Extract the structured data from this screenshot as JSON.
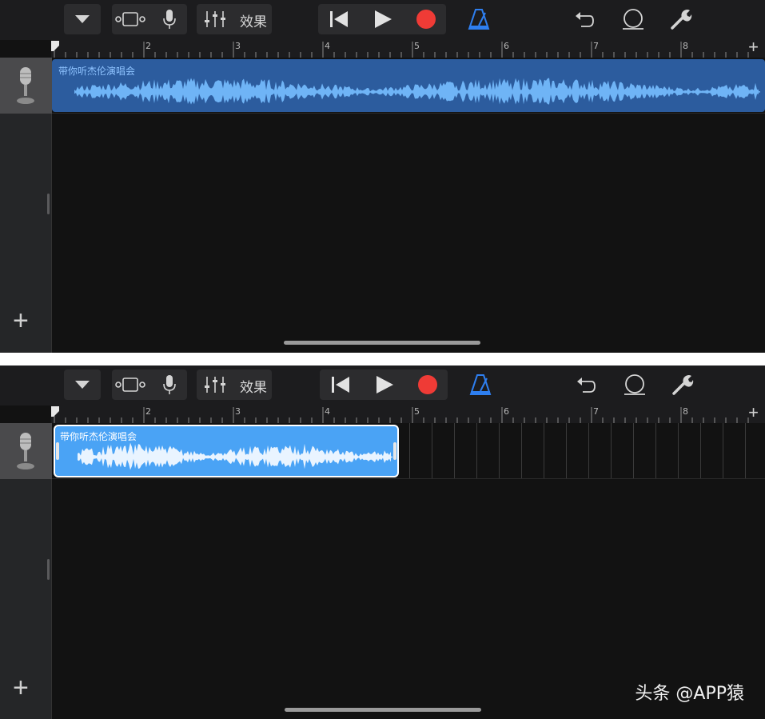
{
  "toolbar": {
    "fx_label": "效果"
  },
  "ruler": {
    "bars": [
      "2",
      "3",
      "4",
      "5",
      "6",
      "7",
      "8"
    ]
  },
  "top_panel": {
    "region_label": "带你听杰伦演唱会"
  },
  "bottom_panel": {
    "region_label": "带你听杰伦演唱会"
  },
  "watermark": {
    "text": "头条 @APP猿"
  },
  "colors": {
    "region_unselected": "#2c5c9e",
    "region_selected": "#4aa3f5",
    "waveform": "#6fb4f6",
    "record": "#ef3b36",
    "metronome": "#2e7ff0"
  },
  "icons": [
    "dropdown-icon",
    "track-view-icon",
    "microphone-icon",
    "mixer-icon",
    "rewind-icon",
    "play-icon",
    "record-icon",
    "metronome-icon",
    "undo-icon",
    "loop-icon",
    "settings-icon",
    "add-track-icon"
  ]
}
